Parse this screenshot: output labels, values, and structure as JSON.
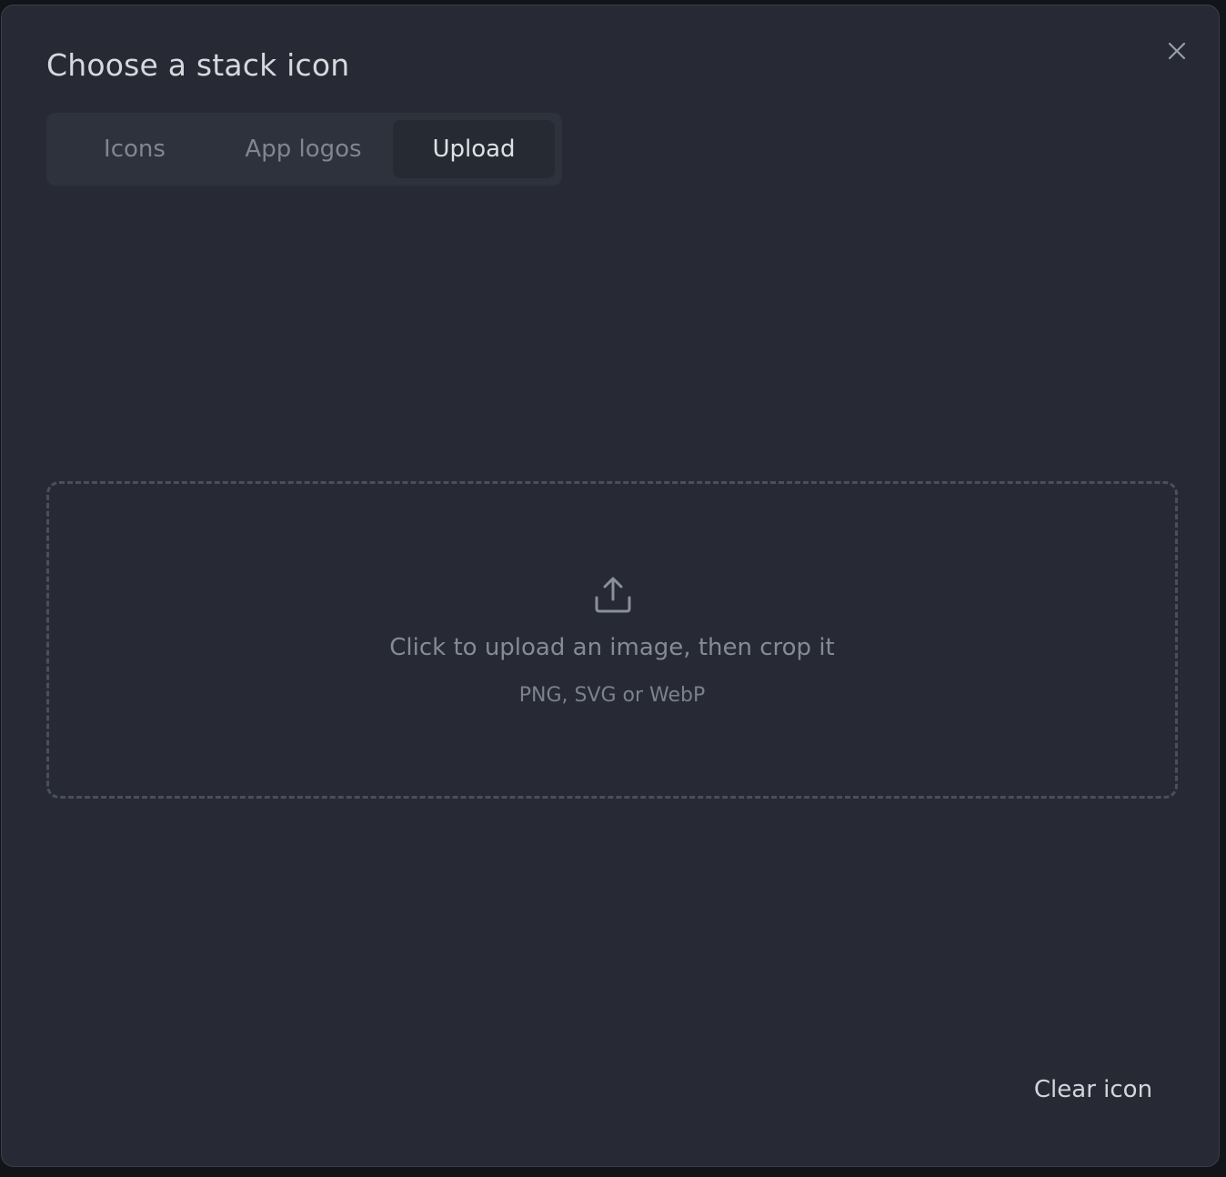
{
  "dialog": {
    "title": "Choose a stack icon",
    "close_icon": "close-icon"
  },
  "tabs": [
    {
      "label": "Icons",
      "active": false
    },
    {
      "label": "App logos",
      "active": false
    },
    {
      "label": "Upload",
      "active": true
    }
  ],
  "upload": {
    "icon": "upload-icon",
    "prompt": "Click to upload an image, then crop it",
    "formats": "PNG, SVG or WebP"
  },
  "footer": {
    "clear_label": "Clear icon"
  },
  "colors": {
    "dialog_bg": "#272a34",
    "tab_bar_bg": "#2e323d",
    "active_tab_bg": "#262a33",
    "text_primary": "#d6d8de",
    "text_muted": "#80858f"
  }
}
